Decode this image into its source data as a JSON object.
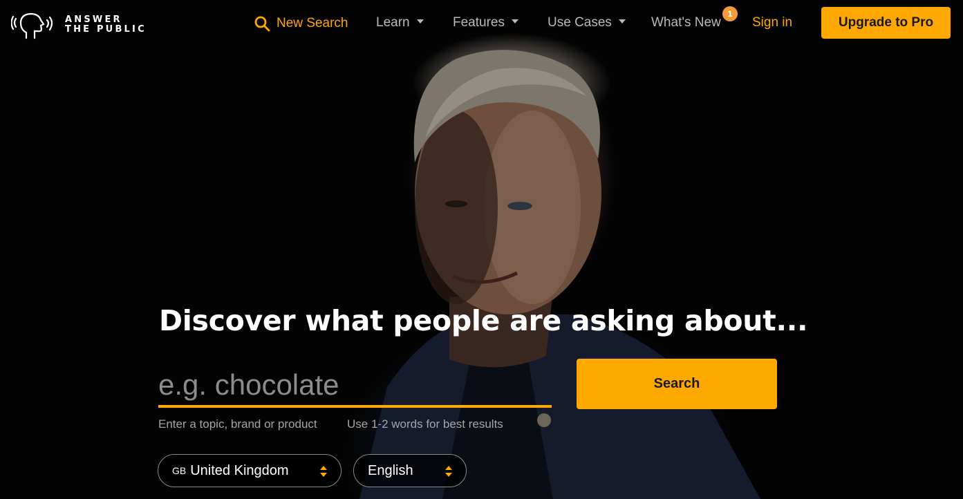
{
  "brand": {
    "logo_line1": "ANSWER",
    "logo_line2": "THE PUBLIC"
  },
  "nav": {
    "new_search": "New Search",
    "learn": "Learn",
    "features": "Features",
    "use_cases": "Use Cases",
    "whats_new": "What's New",
    "whats_new_badge": "1",
    "sign_in": "Sign in",
    "upgrade": "Upgrade to Pro"
  },
  "hero": {
    "headline": "Discover what people are asking about...",
    "search_placeholder": "e.g. chocolate",
    "search_button": "Search",
    "hint_left": "Enter a topic, brand or product",
    "hint_right": "Use 1-2 words for best results",
    "country_code": "GB",
    "country": "United Kingdom",
    "language": "English"
  },
  "colors": {
    "accent": "#ffa800",
    "badge": "#f39a3b",
    "background": "#000000",
    "nav_text": "#b9b9b9"
  },
  "icons": {
    "logo": "speaking-head-icon",
    "new_search": "search-icon",
    "dropdown": "chevron-down-icon",
    "select": "updown-arrows-icon"
  }
}
